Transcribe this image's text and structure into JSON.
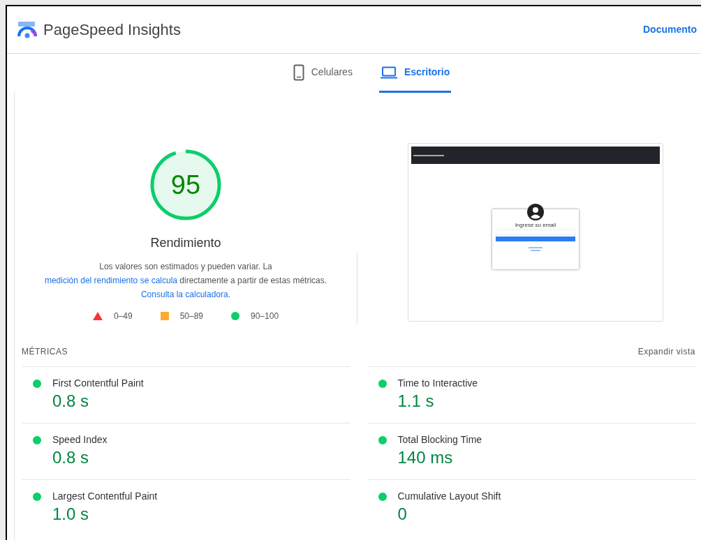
{
  "header": {
    "title": "PageSpeed Insights",
    "link": "Documento"
  },
  "tabs": [
    {
      "label": "Celulares",
      "kind": "phone",
      "selected": false
    },
    {
      "label": "Escritorio",
      "kind": "desktop",
      "selected": true
    }
  ],
  "score": {
    "value": "95",
    "label": "Rendimiento"
  },
  "description": [
    {
      "text": "Los valores son estimados y pueden variar. La ",
      "link": false
    },
    {
      "text": "medición del rendimiento se calcula",
      "link": true
    },
    {
      "text": " directamente a partir de estas métricas. ",
      "link": false
    },
    {
      "text": "Consulta la calculadora.",
      "link": true
    }
  ],
  "legend": [
    {
      "kind": "triangle",
      "label": "0–49"
    },
    {
      "kind": "square",
      "label": "50–89"
    },
    {
      "kind": "circle",
      "label": "90–100"
    }
  ],
  "screenshot": {
    "prompt": "Ingrese su email"
  },
  "metrics_title": "MÉTRICAS",
  "expand": "Expandir vista",
  "metrics": [
    {
      "name": "First Contentful Paint",
      "value": "0.8 s",
      "color": "#0cce6b"
    },
    {
      "name": "Time to Interactive",
      "value": "1.1 s",
      "color": "#0cce6b"
    },
    {
      "name": "Speed Index",
      "value": "0.8 s",
      "color": "#0cce6b"
    },
    {
      "name": "Total Blocking Time",
      "value": "140 ms",
      "color": "#0cce6b"
    },
    {
      "name": "Largest Contentful Paint",
      "value": "1.0 s",
      "color": "#0cce6b"
    },
    {
      "name": "Cumulative Layout Shift",
      "value": "0",
      "color": "#0cce6b"
    }
  ]
}
